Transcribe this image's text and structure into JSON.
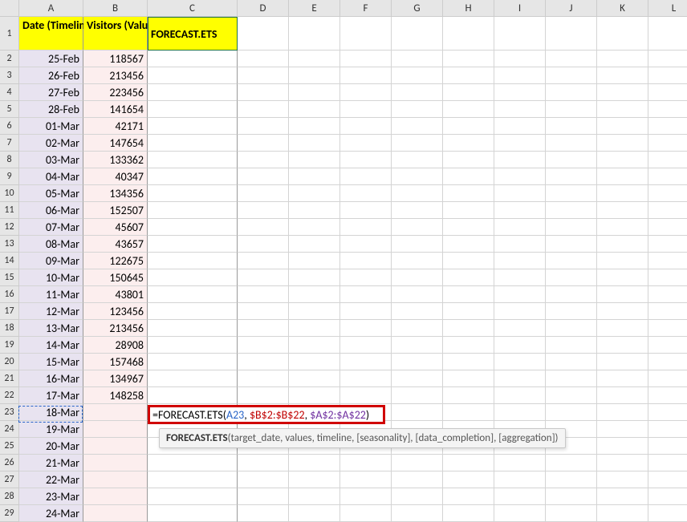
{
  "columns": [
    "A",
    "B",
    "C",
    "D",
    "E",
    "F",
    "G",
    "H",
    "I",
    "J",
    "K",
    "L"
  ],
  "rows": [
    "1",
    "2",
    "3",
    "4",
    "5",
    "6",
    "7",
    "8",
    "9",
    "10",
    "11",
    "12",
    "13",
    "14",
    "15",
    "16",
    "17",
    "18",
    "19",
    "20",
    "21",
    "22",
    "23",
    "24",
    "25",
    "26",
    "27",
    "28",
    "29"
  ],
  "headers": {
    "A": "Date (Timeline)",
    "B": "Visitors (Values)",
    "C": "FORECAST.ETS"
  },
  "data": [
    {
      "date": "25-Feb",
      "visitors": "118567"
    },
    {
      "date": "26-Feb",
      "visitors": "213456"
    },
    {
      "date": "27-Feb",
      "visitors": "223456"
    },
    {
      "date": "28-Feb",
      "visitors": "141654"
    },
    {
      "date": "01-Mar",
      "visitors": "42171"
    },
    {
      "date": "02-Mar",
      "visitors": "147654"
    },
    {
      "date": "03-Mar",
      "visitors": "133362"
    },
    {
      "date": "04-Mar",
      "visitors": "40347"
    },
    {
      "date": "05-Mar",
      "visitors": "134356"
    },
    {
      "date": "06-Mar",
      "visitors": "152507"
    },
    {
      "date": "07-Mar",
      "visitors": "45607"
    },
    {
      "date": "08-Mar",
      "visitors": "43657"
    },
    {
      "date": "09-Mar",
      "visitors": "122675"
    },
    {
      "date": "10-Mar",
      "visitors": "150645"
    },
    {
      "date": "11-Mar",
      "visitors": "43801"
    },
    {
      "date": "12-Mar",
      "visitors": "123456"
    },
    {
      "date": "13-Mar",
      "visitors": "213456"
    },
    {
      "date": "14-Mar",
      "visitors": "28908"
    },
    {
      "date": "15-Mar",
      "visitors": "157468"
    },
    {
      "date": "16-Mar",
      "visitors": "134967"
    },
    {
      "date": "17-Mar",
      "visitors": "148258"
    },
    {
      "date": "18-Mar",
      "visitors": ""
    },
    {
      "date": "19-Mar",
      "visitors": ""
    },
    {
      "date": "20-Mar",
      "visitors": ""
    },
    {
      "date": "21-Mar",
      "visitors": ""
    },
    {
      "date": "22-Mar",
      "visitors": ""
    },
    {
      "date": "23-Mar",
      "visitors": ""
    },
    {
      "date": "24-Mar",
      "visitors": ""
    }
  ],
  "formula": {
    "prefix": "=FORECAST.ETS",
    "open": "(",
    "ref1": "A23",
    "sep1": ", ",
    "ref2": "$B$2:$B$22",
    "sep2": ", ",
    "ref3": "$A$2:$A$22",
    "close": ")"
  },
  "tooltip": {
    "fn": "FORECAST.ETS",
    "args": "(target_date, values, timeline, [seasonality], [data_completion], [aggregation])"
  }
}
